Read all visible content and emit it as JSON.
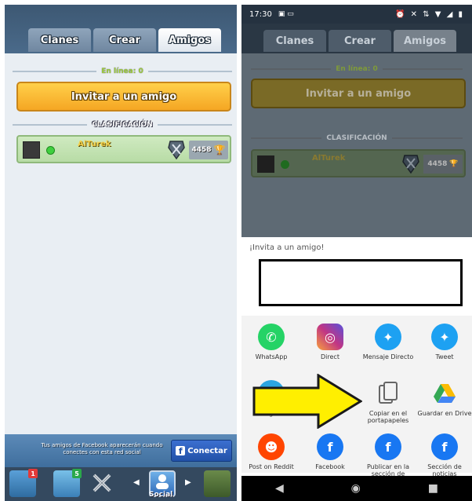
{
  "left": {
    "tabs": [
      {
        "label": "Clanes",
        "active": false
      },
      {
        "label": "Crear",
        "active": false
      },
      {
        "label": "Amigos",
        "active": true
      }
    ],
    "online_label": "En línea: 0",
    "invite_button": "Invitar a un amigo",
    "ranking_label": "CLASIFICACIÓN",
    "friend": {
      "name": "AlTurek",
      "trophies": "4458",
      "status_color": "#3fcf3f"
    },
    "facebook_banner": {
      "text": "Tus amigos de Facebook aparecerán cuando conectes con esta red social",
      "button_label": "Conectar"
    },
    "bottom_nav": {
      "badges": [
        "1",
        "5"
      ],
      "social_label": "Social"
    },
    "colors": {
      "accent": "#f5a623",
      "header": "#3d5873",
      "bg": "#e9eef3"
    }
  },
  "right": {
    "status": {
      "time": "17:30",
      "icons": "⏰ ✕ ⇅ ▼ ◢ ▮"
    },
    "dim_tabs": [
      "Clanes",
      "Crear",
      "Amigos"
    ],
    "dim_online_label": "En línea: 0",
    "dim_invite_button": "Invitar a un amigo",
    "dim_ranking_label": "CLASIFICACIÓN",
    "dim_friend": {
      "name": "AlTurek",
      "trophies": "4458"
    },
    "share": {
      "title": "¡Invita a un amigo!",
      "apps": [
        {
          "name": "WhatsApp",
          "label": "WhatsApp",
          "color": "#25d366",
          "icon": "whatsapp-icon"
        },
        {
          "name": "Direct",
          "label": "Direct",
          "color": "#c13584",
          "icon": "instagram-icon"
        },
        {
          "name": "Mensaje Directo",
          "label": "Mensaje Directo",
          "color": "#1da1f2",
          "icon": "twitter-icon"
        },
        {
          "name": "Tweet",
          "label": "Tweet",
          "color": "#1da1f2",
          "icon": "twitter-icon"
        },
        {
          "name": "Telegram",
          "label": "Telegram",
          "color": "#2ca5e0",
          "icon": "telegram-icon"
        },
        {
          "name": "Copiar en el portapapeles",
          "label": "Copiar en el portapapeles",
          "color": "#ffffff",
          "icon": "copy-icon"
        },
        {
          "name": "Guardar en Drive",
          "label": "Guardar en Drive",
          "color": "#ffffff",
          "icon": "drive-icon"
        },
        {
          "name": "Post on Reddit",
          "label": "Post on Reddit",
          "color": "#ff4500",
          "icon": "reddit-icon"
        },
        {
          "name": "Facebook",
          "label": "Facebook",
          "color": "#1877f2",
          "icon": "facebook-icon"
        },
        {
          "name": "Publicar en la sección de",
          "label": "Publicar en la sección de",
          "color": "#1877f2",
          "icon": "facebook-icon"
        },
        {
          "name": "Sección de noticias",
          "label": "Sección de noticias",
          "color": "#1877f2",
          "icon": "facebook-icon"
        }
      ]
    },
    "nav": {
      "back": "◀",
      "home": "◉",
      "recent": "■"
    },
    "arrow_color": "#ffef00"
  }
}
